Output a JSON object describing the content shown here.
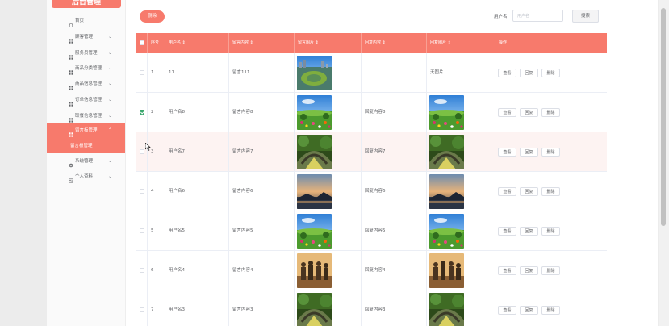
{
  "sidebar": {
    "title": "后台管理",
    "items": [
      {
        "label": "首页",
        "icon": "home-icon",
        "has_chevron": false
      },
      {
        "label": "顾客管理",
        "icon": "grid-icon",
        "has_chevron": true
      },
      {
        "label": "服务员管理",
        "icon": "grid-icon",
        "has_chevron": true
      },
      {
        "label": "商品分类管理",
        "icon": "grid-icon",
        "has_chevron": true
      },
      {
        "label": "商品信息管理",
        "icon": "grid-icon",
        "has_chevron": true
      },
      {
        "label": "订单信息管理",
        "icon": "grid-icon",
        "has_chevron": true
      },
      {
        "label": "取餐信息管理",
        "icon": "grid-icon",
        "has_chevron": true
      },
      {
        "label": "留言板管理",
        "icon": "grid-icon",
        "has_chevron": true,
        "active": true
      },
      {
        "label": "系统管理",
        "icon": "gear-icon",
        "has_chevron": true
      },
      {
        "label": "个人资料",
        "icon": "user-card-icon",
        "has_chevron": true
      }
    ],
    "submenu_label": "留言板管理"
  },
  "toolbar": {
    "delete_label": "删除",
    "search_label": "用户名",
    "search_placeholder": "用户名",
    "search_button": "搜索"
  },
  "table": {
    "headers": [
      "序号",
      "用户名",
      "留言内容",
      "留言图片",
      "回复内容",
      "回复图片",
      "操作"
    ],
    "actions": [
      "查看",
      "回复",
      "删除"
    ],
    "no_image": "无图片",
    "rows": [
      {
        "index": "1",
        "username": "11",
        "content": "留言111",
        "image": "island",
        "reply": "",
        "reply_image": "none",
        "checked": false
      },
      {
        "index": "2",
        "username": "用户名8",
        "content": "留言内容8",
        "image": "flowers",
        "reply": "回复内容8",
        "reply_image": "flowers",
        "checked": true
      },
      {
        "index": "3",
        "username": "用户名7",
        "content": "留言内容7",
        "image": "bridge",
        "reply": "回复内容7",
        "reply_image": "bridge",
        "checked": false
      },
      {
        "index": "4",
        "username": "用户名6",
        "content": "留言内容6",
        "image": "sunset",
        "reply": "回复内容6",
        "reply_image": "sunset",
        "checked": false
      },
      {
        "index": "5",
        "username": "用户名5",
        "content": "留言内容5",
        "image": "flowers",
        "reply": "回复内容5",
        "reply_image": "flowers",
        "checked": false
      },
      {
        "index": "6",
        "username": "用户名4",
        "content": "留言内容4",
        "image": "people",
        "reply": "回复内容4",
        "reply_image": "people",
        "checked": false
      },
      {
        "index": "7",
        "username": "用户名3",
        "content": "留言内容3",
        "image": "bridge",
        "reply": "回复内容3",
        "reply_image": "bridge",
        "checked": false
      }
    ]
  },
  "colors": {
    "accent": "#f77a6c",
    "checkbox_checked": "#3aa76d"
  }
}
